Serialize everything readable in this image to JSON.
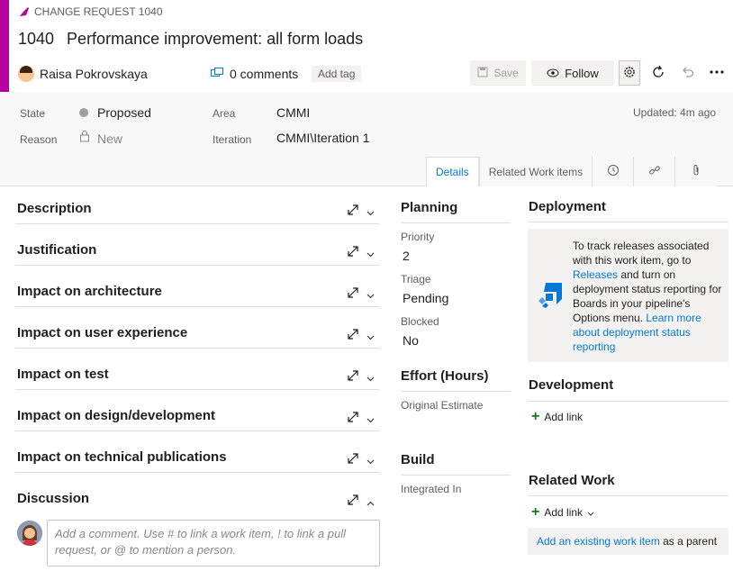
{
  "work_item": {
    "type_label": "CHANGE REQUEST 1040",
    "id": "1040",
    "title": "Performance improvement: all form loads",
    "assigned_to": "Raisa Pokrovskaya",
    "comments": "0 comments",
    "add_tag": "Add tag"
  },
  "toolbar": {
    "save_label": "Save",
    "follow_label": "Follow"
  },
  "fields": {
    "state_label": "State",
    "state_value": "Proposed",
    "reason_label": "Reason",
    "reason_value": "New",
    "area_label": "Area",
    "area_value": "CMMI",
    "iteration_label": "Iteration",
    "iteration_value": "CMMI\\Iteration 1",
    "updated": "Updated: 4m ago"
  },
  "tabs": {
    "details": "Details",
    "related": "Related Work items"
  },
  "sections": [
    "Description",
    "Justification",
    "Impact on architecture",
    "Impact on user experience",
    "Impact on test",
    "Impact on design/development",
    "Impact on technical publications",
    "Discussion"
  ],
  "discussion": {
    "placeholder": "Add a comment. Use # to link a work item, ! to link a pull request, or @ to mention a person."
  },
  "planning": {
    "title": "Planning",
    "priority_label": "Priority",
    "priority_value": "2",
    "triage_label": "Triage",
    "triage_value": "Pending",
    "blocked_label": "Blocked",
    "blocked_value": "No"
  },
  "effort": {
    "title": "Effort (Hours)",
    "original_estimate_label": "Original Estimate"
  },
  "build": {
    "title": "Build",
    "integrated_in_label": "Integrated In"
  },
  "deployment": {
    "title": "Deployment",
    "text1": "To track releases associated with this work item, go to ",
    "link1": "Releases",
    "text2": " and turn on deployment status reporting for Boards in your pipeline's Options menu. ",
    "link2": "Learn more about deployment status reporting"
  },
  "development": {
    "title": "Development",
    "add_link": "Add link"
  },
  "related_work": {
    "title": "Related Work",
    "add_link": "Add link",
    "existing_link": "Add an existing work item",
    "existing_suffix": " as a parent"
  },
  "colors": {
    "accent": "#b4009e",
    "link": "#0078d4",
    "add": "#107c10"
  }
}
